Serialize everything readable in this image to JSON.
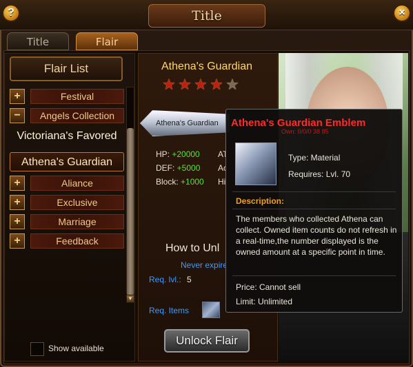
{
  "window": {
    "title": "Title",
    "help_label": "?",
    "close_label": "×"
  },
  "tabs": [
    {
      "label": "Title",
      "active": false
    },
    {
      "label": "Flair",
      "active": true
    }
  ],
  "flair_list": {
    "header": "Flair List",
    "rows": [
      {
        "type": "category",
        "sign": "+",
        "label": "Festival"
      },
      {
        "type": "category",
        "sign": "−",
        "label": "Angels Collection"
      },
      {
        "type": "item",
        "label": "Victoriana's Favored"
      },
      {
        "type": "item",
        "label": "Athena's Guardian",
        "selected": true
      },
      {
        "type": "category",
        "sign": "+",
        "label": "Aliance"
      },
      {
        "type": "category",
        "sign": "+",
        "label": "Exclusive"
      },
      {
        "type": "category",
        "sign": "+",
        "label": "Marriage"
      },
      {
        "type": "category",
        "sign": "+",
        "label": "Feedback"
      }
    ],
    "show_available": "Show available"
  },
  "detail": {
    "name": "Athena's Guardian",
    "stars": 4.5,
    "emblem_label": "Athena's Guardian",
    "stats": [
      {
        "label": "HP: ",
        "value": "+20000"
      },
      {
        "label": "DEF: ",
        "value": "+5000"
      },
      {
        "label": "Block: ",
        "value": "+1000"
      }
    ],
    "stats_right": [
      "AT",
      "Ac",
      "Hi"
    ],
    "how_to": "How to Unl",
    "never_expire": "Never expire",
    "req_lvl_label": "Req. lvl.:",
    "req_lvl_value": "5",
    "req_items_label": "Req. Items",
    "unlock_button": "Unlock Flair"
  },
  "tooltip": {
    "title": "Athena's Guardian Emblem",
    "own": "Own: 0/0/0 38 85",
    "type": "Type: Material",
    "requires": "Requires: Lvl. 70",
    "description_header": "Description:",
    "description": "The members who collected Athena can collect. Owned item counts do not refresh in a real-time,the number displayed is the owned amount at a specific point in time.",
    "price": "Price: Cannot sell",
    "limit": "Limit: Unlimited"
  }
}
